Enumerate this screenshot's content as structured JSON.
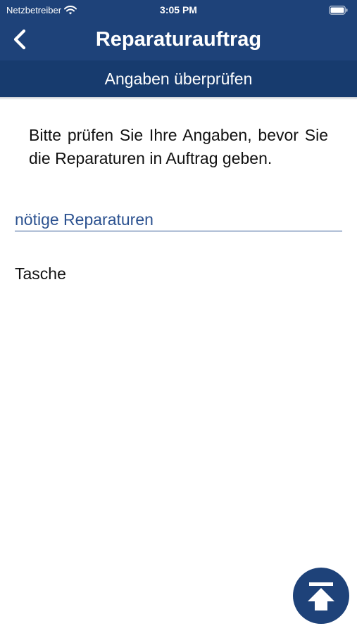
{
  "status_bar": {
    "carrier": "Netzbetreiber",
    "time": "3:05 PM"
  },
  "header": {
    "title": "Reparaturauftrag",
    "subtitle": "Angaben überprüfen",
    "back_icon": "chevron-left-icon"
  },
  "content": {
    "intro": "Bitte prüfen Sie Ihre Angaben, bevor Sie die Reparaturen in Auftrag geben.",
    "section_title": "nötige Reparaturen",
    "items": [
      "Tasche"
    ]
  },
  "scroll_top_icon": "arrow-up-to-top-icon",
  "colors": {
    "header": "#1e4279",
    "subheader": "#173b6e",
    "accent_text": "#2c5290"
  }
}
